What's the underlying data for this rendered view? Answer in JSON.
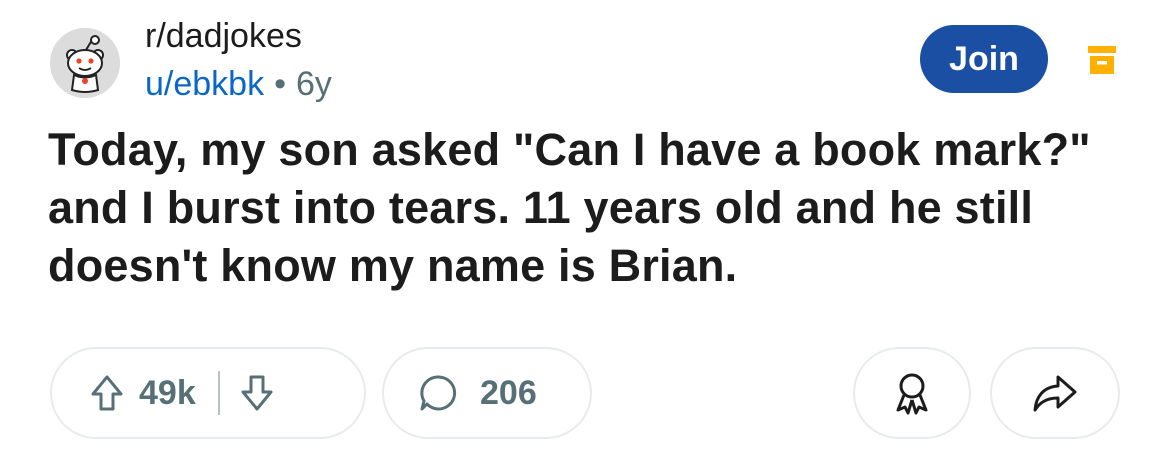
{
  "post": {
    "subreddit": "r/dadjokes",
    "author": "u/ebkbk",
    "separator": "•",
    "age": "6y",
    "title": "Today, my son asked \"Can I have a book mark?\" and I burst into tears. 11 years old and he still doesn't know my name is Brian."
  },
  "header": {
    "join_label": "Join",
    "avatar_icon": "reddit-snoo-icon",
    "archive_icon": "archive-icon",
    "archive_color": "#ffb000",
    "join_color": "#1a4fa3"
  },
  "actions": {
    "upvote_icon": "upvote-arrow-icon",
    "score": "49k",
    "downvote_icon": "downvote-arrow-icon",
    "comment_icon": "comment-bubble-icon",
    "comment_count": "206",
    "award_icon": "award-icon",
    "share_icon": "share-arrow-icon"
  }
}
